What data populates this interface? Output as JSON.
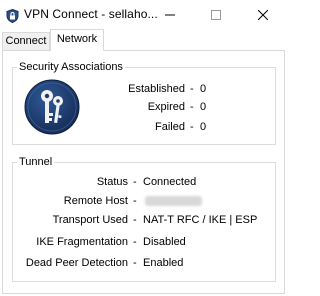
{
  "window": {
    "title": "VPN Connect - sellaho...",
    "icon": "shield-lock-icon",
    "controls": [
      "minimize",
      "maximize",
      "close"
    ]
  },
  "tabs": [
    {
      "label": "Connect",
      "selected": false
    },
    {
      "label": "Network",
      "selected": true
    }
  ],
  "security_associations": {
    "title": "Security Associations",
    "icon": "keys-icon",
    "rows": [
      {
        "label": "Established",
        "sep": "-",
        "value": "0"
      },
      {
        "label": "Expired",
        "sep": "-",
        "value": "0"
      },
      {
        "label": "Failed",
        "sep": "-",
        "value": "0"
      }
    ]
  },
  "tunnel": {
    "title": "Tunnel",
    "rows": [
      {
        "label": "Status",
        "sep": "-",
        "value": "Connected"
      },
      {
        "label": "Remote Host",
        "sep": "-",
        "value": ""
      },
      {
        "label": "Transport Used",
        "sep": "-",
        "value": "NAT-T RFC / IKE | ESP"
      },
      {
        "label": "IKE Fragmentation",
        "sep": "-",
        "value": "Disabled"
      },
      {
        "label": "Dead Peer Detection",
        "sep": "-",
        "value": "Enabled"
      }
    ]
  },
  "colors": {
    "key_badge": "#1c3a6e",
    "border": "#d9d9d9"
  }
}
